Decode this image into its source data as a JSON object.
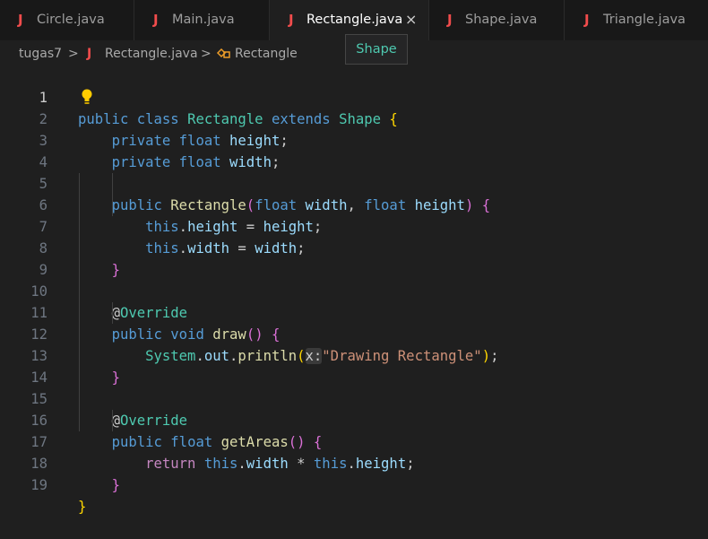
{
  "tabs": [
    {
      "icon": "J",
      "label": "Circle.java"
    },
    {
      "icon": "J",
      "label": "Main.java"
    },
    {
      "icon": "J",
      "label": "Rectangle.java"
    },
    {
      "icon": "J",
      "label": "Shape.java"
    },
    {
      "icon": "J",
      "label": "Triangle.java"
    }
  ],
  "close_glyph": "×",
  "breadcrumb": {
    "folder": "tugas7",
    "sep": ">",
    "file_icon": "J",
    "file": "Rectangle.java",
    "symbol": "Rectangle"
  },
  "tooltip": "Shape",
  "code": {
    "line_numbers": [
      "1",
      "2",
      "3",
      "4",
      "5",
      "6",
      "7",
      "8",
      "9",
      "10",
      "11",
      "12",
      "13",
      "14",
      "15",
      "16",
      "17",
      "18",
      "19"
    ],
    "t": {
      "public": "public",
      "class": "class",
      "Rectangle": "Rectangle",
      "extends": "extends",
      "Shape": "Shape",
      "lbrace": "{",
      "rbrace": "}",
      "private": "private",
      "float": "float",
      "height": "height",
      "width": "width",
      "semi": ";",
      "lparen": "(",
      "rparen": ")",
      "comma": ",",
      "this": "this",
      "dot": ".",
      "eq": "=",
      "at": "@",
      "Override": "Override",
      "void": "void",
      "draw": "draw",
      "System": "System",
      "out": "out",
      "println": "println",
      "hint_x": "x:",
      "str": "\"Drawing Rectangle\"",
      "getAreas": "getAreas",
      "return": "return",
      "mul": "*"
    }
  },
  "colors": {
    "background": "#1f1f1f",
    "keyword": "#569cd6",
    "type": "#4ec9b0",
    "variable": "#9cdcfe",
    "function": "#dcdcaa",
    "string": "#ce9178",
    "control": "#c586c0",
    "java_icon": "#f14c4c"
  },
  "icons": {
    "java_file": "java-file-icon",
    "lightbulb": "lightbulb-icon",
    "symbol_class": "class-symbol-icon",
    "close": "close-icon"
  }
}
